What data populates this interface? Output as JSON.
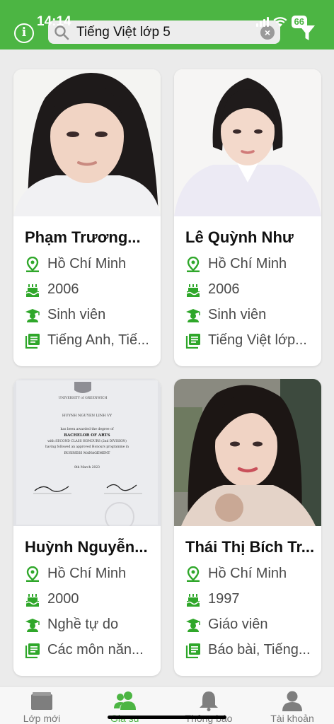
{
  "status": {
    "time": "14:14",
    "battery": "66"
  },
  "header": {
    "search_value": "Tiếng Việt lớp 5"
  },
  "cards": [
    {
      "name": "Phạm Trương...",
      "location": "Hồ Chí Minh",
      "birth_year": "2006",
      "occupation": "Sinh viên",
      "subjects": "Tiếng Anh, Tiế..."
    },
    {
      "name": "Lê Quỳnh Như",
      "location": "Hồ Chí Minh",
      "birth_year": "2006",
      "occupation": "Sinh viên",
      "subjects": "Tiếng Việt lớp..."
    },
    {
      "name": "Huỳnh Nguyễn...",
      "location": "Hồ Chí Minh",
      "birth_year": "2000",
      "occupation": "Nghề tự do",
      "subjects": "Các môn năn...",
      "certificate": {
        "line1": "UNIVERSITY of GREENWICH",
        "line2": "HUYNH NGUYEN LINH VY",
        "line3": "has been awarded the degree of",
        "line4": "BACHELOR OF ARTS",
        "line5": "with SECOND CLASS HONOURS (2nd DIVISION)",
        "line6": "having followed an approved Honours programme in",
        "line7": "BUSINESS MANAGEMENT",
        "line8": "8th March 2023"
      }
    },
    {
      "name": "Thái Thị Bích Tr...",
      "location": "Hồ Chí Minh",
      "birth_year": "1997",
      "occupation": "Giáo viên",
      "subjects": "Báo bài, Tiếng..."
    }
  ],
  "bottom_nav": [
    {
      "label": "Lớp mới",
      "icon": "folder-icon"
    },
    {
      "label": "Gia sư",
      "icon": "users-icon"
    },
    {
      "label": "Thông báo",
      "icon": "bell-icon"
    },
    {
      "label": "Tài khoản",
      "icon": "user-icon"
    }
  ],
  "colors": {
    "brand_green": "#4cb543",
    "icon_green": "#2fa72a",
    "text_gray": "#4a4a4a"
  }
}
